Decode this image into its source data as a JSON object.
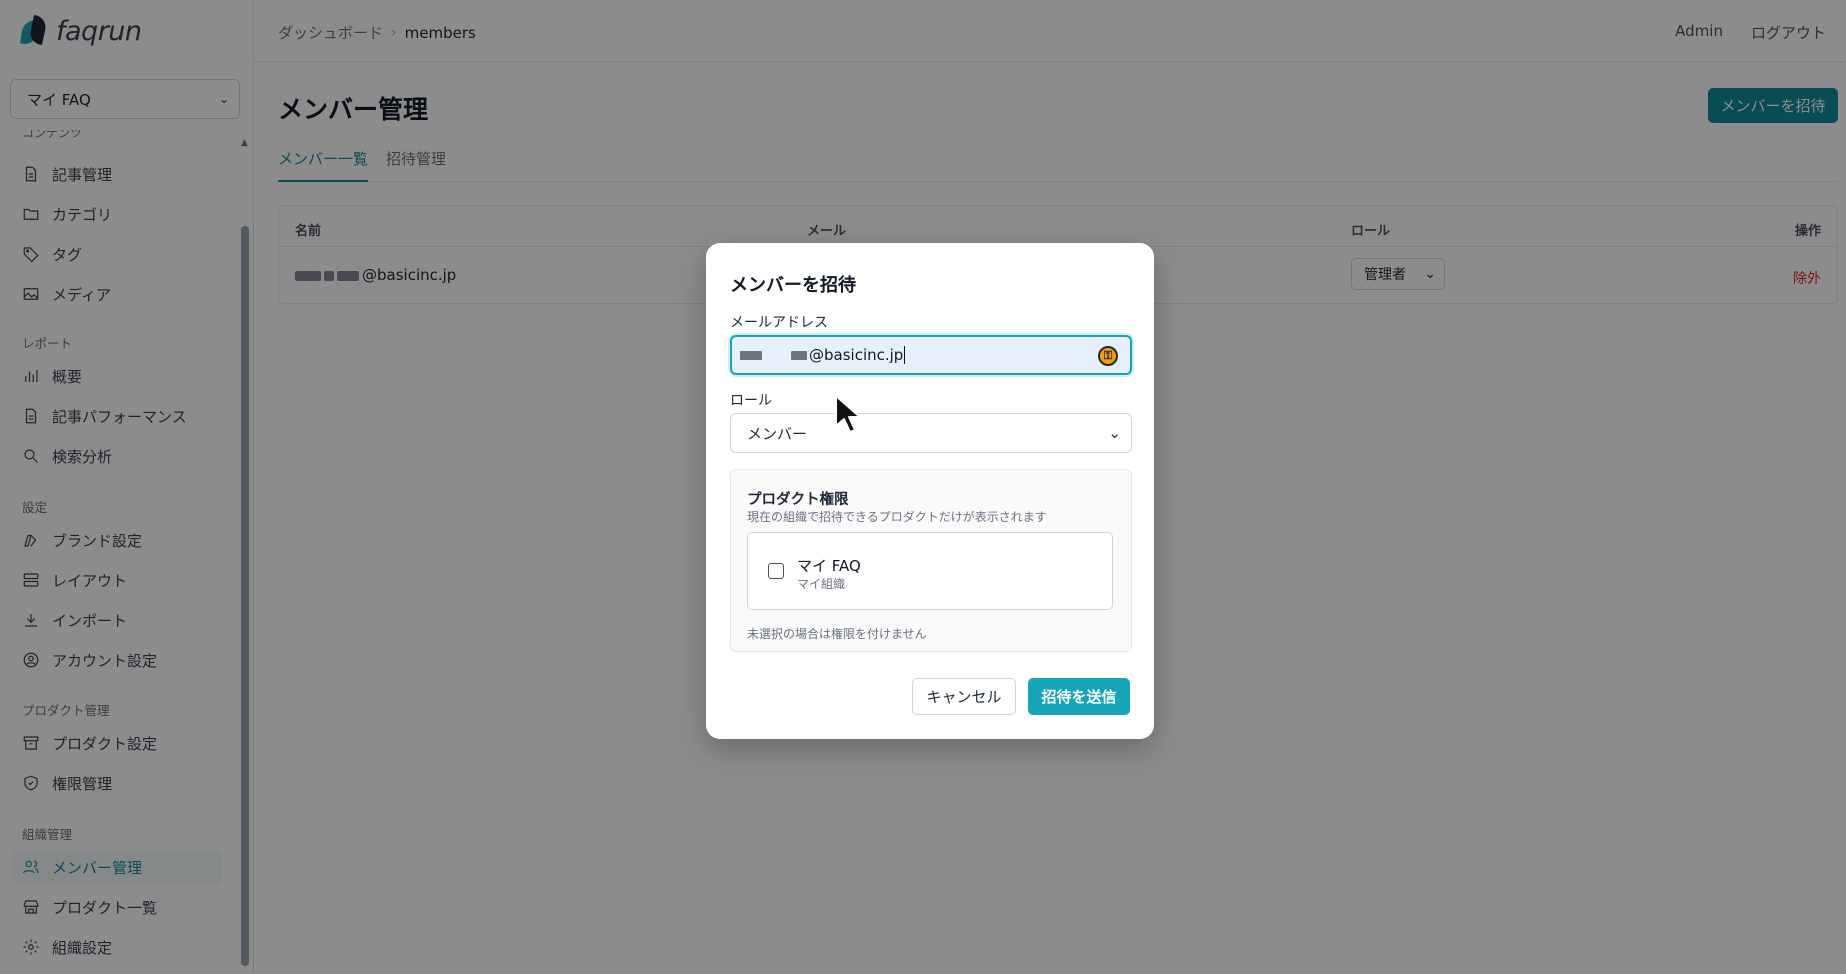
{
  "brand": {
    "name": "faqrun"
  },
  "org_select": {
    "value": "マイ FAQ"
  },
  "sidebar": {
    "cut_section": "コンテンツ",
    "sections": {
      "report": "レポート",
      "settings": "設定",
      "product": "プロダクト管理",
      "org": "組織管理"
    },
    "items": {
      "articles": "記事管理",
      "categories": "カテゴリ",
      "tags": "タグ",
      "media": "メディア",
      "overview": "概要",
      "article_perf": "記事パフォーマンス",
      "search_analysis": "検索分析",
      "brand_settings": "ブランド設定",
      "layout": "レイアウト",
      "import": "インポート",
      "account_settings": "アカウント設定",
      "product_settings": "プロダクト設定",
      "permissions": "権限管理",
      "members": "メンバー管理",
      "product_list": "プロダクト一覧",
      "org_settings": "組織設定"
    }
  },
  "header": {
    "breadcrumb": [
      "ダッシュボード",
      "members"
    ],
    "user": "Admin",
    "logout": "ログアウト"
  },
  "main": {
    "title": "メンバー管理",
    "invite_button": "メンバーを招待",
    "tabs": [
      "メンバー一覧",
      "招待管理"
    ],
    "table": {
      "headers": {
        "name": "名前",
        "email": "メール",
        "role": "ロール",
        "actions": "操作"
      },
      "row": {
        "name_suffix": "@basicinc.jp",
        "role": "管理者",
        "remove": "除外"
      }
    }
  },
  "modal": {
    "title": "メンバーを招待",
    "email_label": "メールアドレス",
    "email_value_suffix": "@basicinc.jp",
    "role_label": "ロール",
    "role_value": "メンバー",
    "perm_title": "プロダクト権限",
    "perm_sub": "現在の組織で招待できるプロダクトだけが表示されます",
    "perm_item_name": "マイ FAQ",
    "perm_item_org": "マイ組織",
    "perm_note": "未選択の場合は権限を付けません",
    "cancel": "キャンセル",
    "send": "招待を送信"
  },
  "colors": {
    "accent": "#0f8a9b",
    "accent_light": "#14a5b8",
    "danger": "#dc2626"
  }
}
